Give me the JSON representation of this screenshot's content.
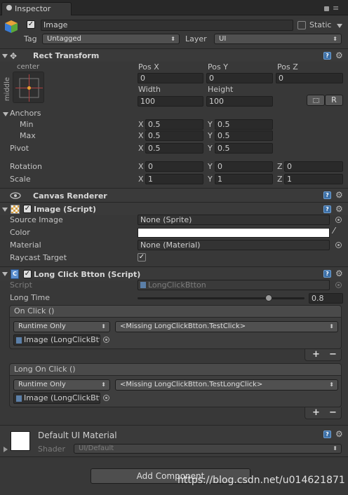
{
  "tab": {
    "title": "Inspector"
  },
  "object": {
    "name": "Image",
    "static_label": "Static",
    "tag_label": "Tag",
    "tag_value": "Untagged",
    "layer_label": "Layer",
    "layer_value": "UI"
  },
  "rect_transform": {
    "title": "Rect Transform",
    "anchor_h": "center",
    "anchor_v": "middle",
    "pos_x_label": "Pos X",
    "pos_y_label": "Pos Y",
    "pos_z_label": "Pos Z",
    "pos_x": "0",
    "pos_y": "0",
    "pos_z": "0",
    "width_label": "Width",
    "height_label": "Height",
    "width": "100",
    "height": "100",
    "r_button": "R",
    "anchors_label": "Anchors",
    "min_label": "Min",
    "max_label": "Max",
    "min_x": "0.5",
    "min_y": "0.5",
    "max_x": "0.5",
    "max_y": "0.5",
    "pivot_label": "Pivot",
    "pivot_x": "0.5",
    "pivot_y": "0.5",
    "rotation_label": "Rotation",
    "rot_x": "0",
    "rot_y": "0",
    "rot_z": "0",
    "scale_label": "Scale",
    "scale_x": "1",
    "scale_y": "1",
    "scale_z": "1",
    "x": "X",
    "y": "Y",
    "z": "Z"
  },
  "canvas_renderer": {
    "title": "Canvas Renderer"
  },
  "image_script": {
    "title": "Image (Script)",
    "source_image_label": "Source Image",
    "source_image_value": "None (Sprite)",
    "color_label": "Color",
    "material_label": "Material",
    "material_value": "None (Material)",
    "raycast_label": "Raycast Target"
  },
  "long_click": {
    "title": "Long Click Btton (Script)",
    "script_label": "Script",
    "script_value": "LongClickBtton",
    "long_time_label": "Long Time",
    "long_time_value": "0.8",
    "long_time_fraction": 0.8,
    "on_click_label": "On Click ()",
    "on_click_mode": "Runtime Only",
    "on_click_function": "<Missing LongClickBtton.TestClick>",
    "on_click_target": "Image (LongClickBtton)",
    "long_on_click_label": "Long On Click ()",
    "long_on_click_mode": "Runtime Only",
    "long_on_click_function": "<Missing LongClickBtton.TestLongClick>",
    "long_on_click_target": "Image (LongClickBtton)",
    "plus": "+",
    "minus": "−"
  },
  "material": {
    "title": "Default UI Material",
    "shader_label": "Shader",
    "shader_value": "UI/Default"
  },
  "add_component": "Add Component",
  "watermark": "https://blog.csdn.net/u014621871"
}
